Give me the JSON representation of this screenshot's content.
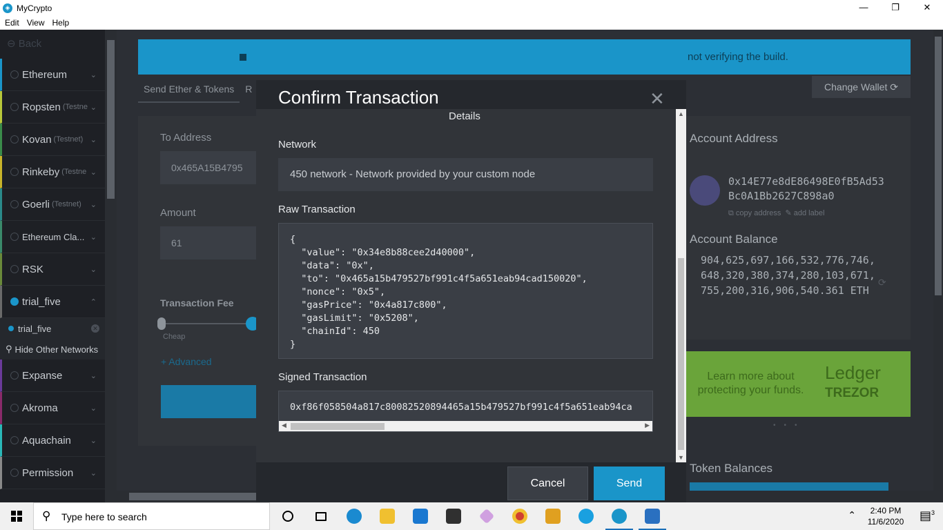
{
  "window": {
    "title": "MyCrypto",
    "minimize": "—",
    "maximize": "❐",
    "close": "✕"
  },
  "menu": [
    "Edit",
    "View",
    "Help"
  ],
  "sidebar": {
    "back": "Back",
    "items": [
      {
        "label": "Ethereum",
        "sub": "",
        "chevron": "⌄"
      },
      {
        "label": "Ropsten",
        "sub": "(Testne",
        "chevron": "⌄"
      },
      {
        "label": "Kovan",
        "sub": "(Testnet)",
        "chevron": "⌄"
      },
      {
        "label": "Rinkeby",
        "sub": "(Testne",
        "chevron": "⌄"
      },
      {
        "label": "Goerli",
        "sub": "(Testnet)",
        "chevron": "⌄"
      },
      {
        "label": "Ethereum Cla...",
        "sub": "",
        "chevron": "⌄"
      },
      {
        "label": "RSK",
        "sub": "",
        "chevron": "⌄"
      },
      {
        "label": "trial_five",
        "sub": "",
        "chevron": "⌃"
      }
    ],
    "subitem": "trial_five",
    "hide_other": "Hide Other Networks",
    "more_items": [
      {
        "label": "Expanse",
        "chevron": "⌄"
      },
      {
        "label": "Akroma",
        "chevron": "⌄"
      },
      {
        "label": "Aquachain",
        "chevron": "⌄"
      },
      {
        "label": "Permission",
        "chevron": "⌄"
      }
    ],
    "accent_colors": [
      "#1a95c9",
      "#b8c83a",
      "#c8b42a",
      "#3a8c4a",
      "#2a8a8a",
      "#3a8a6a",
      "#6a8a3a",
      "#6a6a6a",
      "#6a3a9a",
      "#8a2a6a",
      "#2ab8b8",
      "#8a8a8a"
    ]
  },
  "background": {
    "banner_text": "not verifying the build.",
    "tabs": [
      "Send Ether & Tokens",
      "R"
    ],
    "change_wallet": "Change Wallet",
    "to_address_label": "To Address",
    "to_address_value": "0x465A15B4795",
    "amount_label": "Amount",
    "amount_value": "61",
    "fee_label": "Transaction Fee",
    "cheap_label": "Cheap",
    "advanced_label": "+ Advanced",
    "account_address_title": "Account Address",
    "account_address": "0x14E77e8dE86498E0fB5Ad53Bc0A1Bb2627C898a0",
    "copy_address": "copy address",
    "add_label": "add label",
    "account_balance_title": "Account Balance",
    "account_balance": "904,625,697,166,532,776,746,648,320,380,374,280,103,671,755,200,316,906,540.361 ETH",
    "ledger_text": "Learn more about protecting your funds.",
    "ledger_brand": "Ledger",
    "trezor_brand": "TREZOR",
    "token_balances_title": "Token Balances"
  },
  "modal": {
    "title": "Confirm Transaction",
    "close": "✕",
    "details": "Details",
    "network_label": "Network",
    "network_value": "450 network - Network provided by your custom node",
    "raw_label": "Raw Transaction",
    "raw_tx": "{\n  \"value\": \"0x34e8b88cee2d40000\",\n  \"data\": \"0x\",\n  \"to\": \"0x465a15b479527bf991c4f5a651eab94cad150020\",\n  \"nonce\": \"0x5\",\n  \"gasPrice\": \"0x4a817c800\",\n  \"gasLimit\": \"0x5208\",\n  \"chainId\": 450\n}",
    "signed_label": "Signed Transaction",
    "signed_tx": "0xf86f058504a817c80082520894465a15b479527bf991c4f5a651eab94ca",
    "cancel": "Cancel",
    "send": "Send"
  },
  "taskbar": {
    "search_placeholder": "Type here to search",
    "time": "2:40 PM",
    "date": "11/6/2020",
    "notification_count": "3",
    "apps": [
      "cortana-icon",
      "task-view-icon",
      "edge-icon",
      "file-explorer-icon",
      "mail-icon",
      "store-icon",
      "paint-icon",
      "chrome-icon",
      "media-icon",
      "skype-icon",
      "mycrypto-icon",
      "photos-icon"
    ]
  }
}
